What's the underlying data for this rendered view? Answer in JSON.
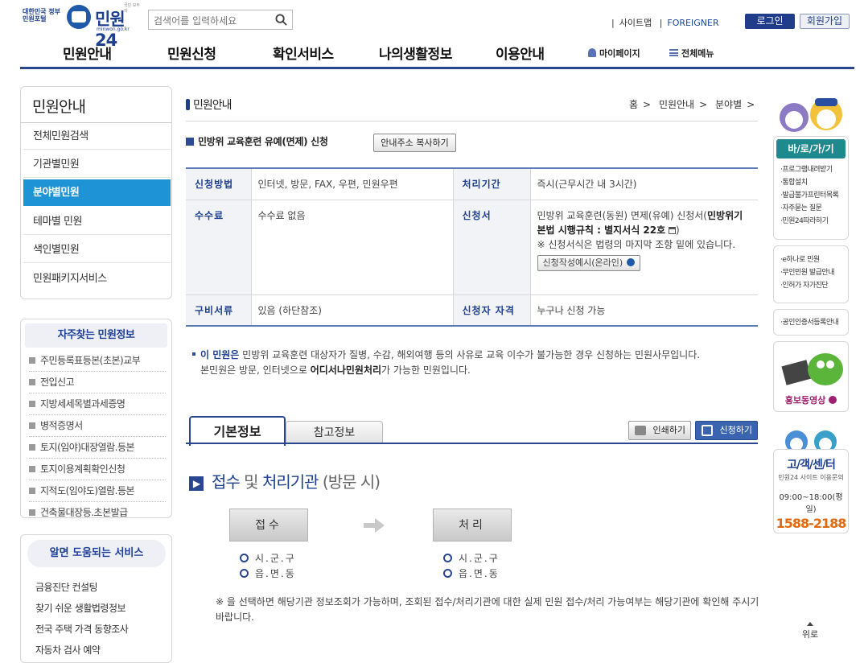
{
  "header": {
    "logo_gov": "대한민국 정부민원포털",
    "logo_main": "민원24",
    "logo_sub": "minwon.go.kr",
    "logo_tag": "국민 모두의",
    "search_placeholder": "검색어를 입력하세요",
    "links": [
      "사이트맵",
      "FOREIGNER"
    ],
    "login": "로그인",
    "join": "회원가입"
  },
  "gnb": {
    "menus": [
      "민원안내",
      "민원신청",
      "확인서비스",
      "나의생활정보",
      "이용안내"
    ],
    "mypage": "마이페이지",
    "allmenu": "전체메뉴"
  },
  "lnb": {
    "title": "민원안내",
    "items": [
      "전체민원검색",
      "기관별민원",
      "분야별민원",
      "테마별 민원",
      "색인별민원",
      "민원패키지서비스"
    ]
  },
  "frequent": {
    "title": "자주찾는 민원정보",
    "items": [
      "주민등록표등본(초본)교부",
      "전입신고",
      "지방세세목별과세증명",
      "병적증명서",
      "토지(임야)대장열람.등본",
      "토지이용계획확인신청",
      "지적도(임야도)열람.등본",
      "건축물대장등.초본발급"
    ]
  },
  "help": {
    "title": "알면 도움되는 서비스",
    "items": [
      "금융진단 컨설팅",
      "찾기 쉬운 생활법령정보",
      "전국 주택 가격 동향조사",
      "자동차 검사 예약"
    ]
  },
  "main": {
    "title": "민원안내",
    "breadcrumb": [
      "홈",
      "민원안내",
      "분야별"
    ],
    "service_name": "민방위 교육훈련 유예(면제) 신청",
    "copy_button": "안내주소 복사하기",
    "table": {
      "method_label": "신청방법",
      "method": "인터넷, 방문, FAX, 우편, 민원우편",
      "period_label": "처리기간",
      "period": "즉시(근무시간 내 3시간)",
      "fee_label": "수수료",
      "fee": "수수료 없음",
      "form_label": "신청서",
      "form_text": "민방위 교육훈련(동원) 면제(유예) 신청서(",
      "form_bold": "민방위기본법 시행규칙 : 별지서식 22호",
      "form_note": "※ 신청서식은 법령의 마지막 조항 밑에 있습니다.",
      "form_button": "신청작성예시(온라인)",
      "docs_label": "구비서류",
      "docs": "있음 (하단참조)",
      "who_label": "신청자 자격",
      "who": "누구나 신청 가능"
    },
    "desc": {
      "lead": "이 민원은",
      "text1": "민방위 교육훈련 대상자가 질병, 수감, 해외여행 등의 사유로 교육 이수가 불가능한 경우 신청하는 민원사무입니다.",
      "text2a": "본민원은 방문, 인터넷으로 ",
      "text2b": "어디서나민원처리",
      "text2c": "가 가능한 민원입니다."
    },
    "tabs": [
      "기본정보",
      "참고정보"
    ],
    "print": "인쇄하기",
    "apply": "신청하기",
    "section": {
      "a": "접수",
      "b": "및",
      "c": "처리기관",
      "d": "(방문 시)"
    },
    "receipt": "접수",
    "process": "처리",
    "orgs": [
      "시.군.구",
      "읍.면.동"
    ],
    "note": "※ 을 선택하면 해당기관 정보조회가 가능하며, 조회된 접수/처리기관에 대한 실제 민원 접수/처리 가능여부는 해당기관에 확인해 주시기 바랍니다."
  },
  "right": {
    "goto_title": "바/로/가/기",
    "goto_items": [
      "·프로그램내려받기",
      "·통합설치",
      "·발급불가프린터목록",
      "·자주묻는 질문",
      "·민원24따라하기"
    ],
    "links2": [
      "·e하나로 민원",
      "·무인민원 발급안내",
      "·인허가 자가진단"
    ],
    "links3": [
      "·공인인증서등록안내"
    ],
    "promo": "홍보동영상",
    "cs_title": "고/객/센/터",
    "cs_sub": "민원24 사이트 이용문의",
    "cs_hours": "09:00~18:00(평일)",
    "cs_phone": "1588-2188",
    "top": "위로"
  },
  "colors": {
    "brand": "#2a4691",
    "active": "#1e94d6",
    "teal": "#1f8a8e"
  }
}
